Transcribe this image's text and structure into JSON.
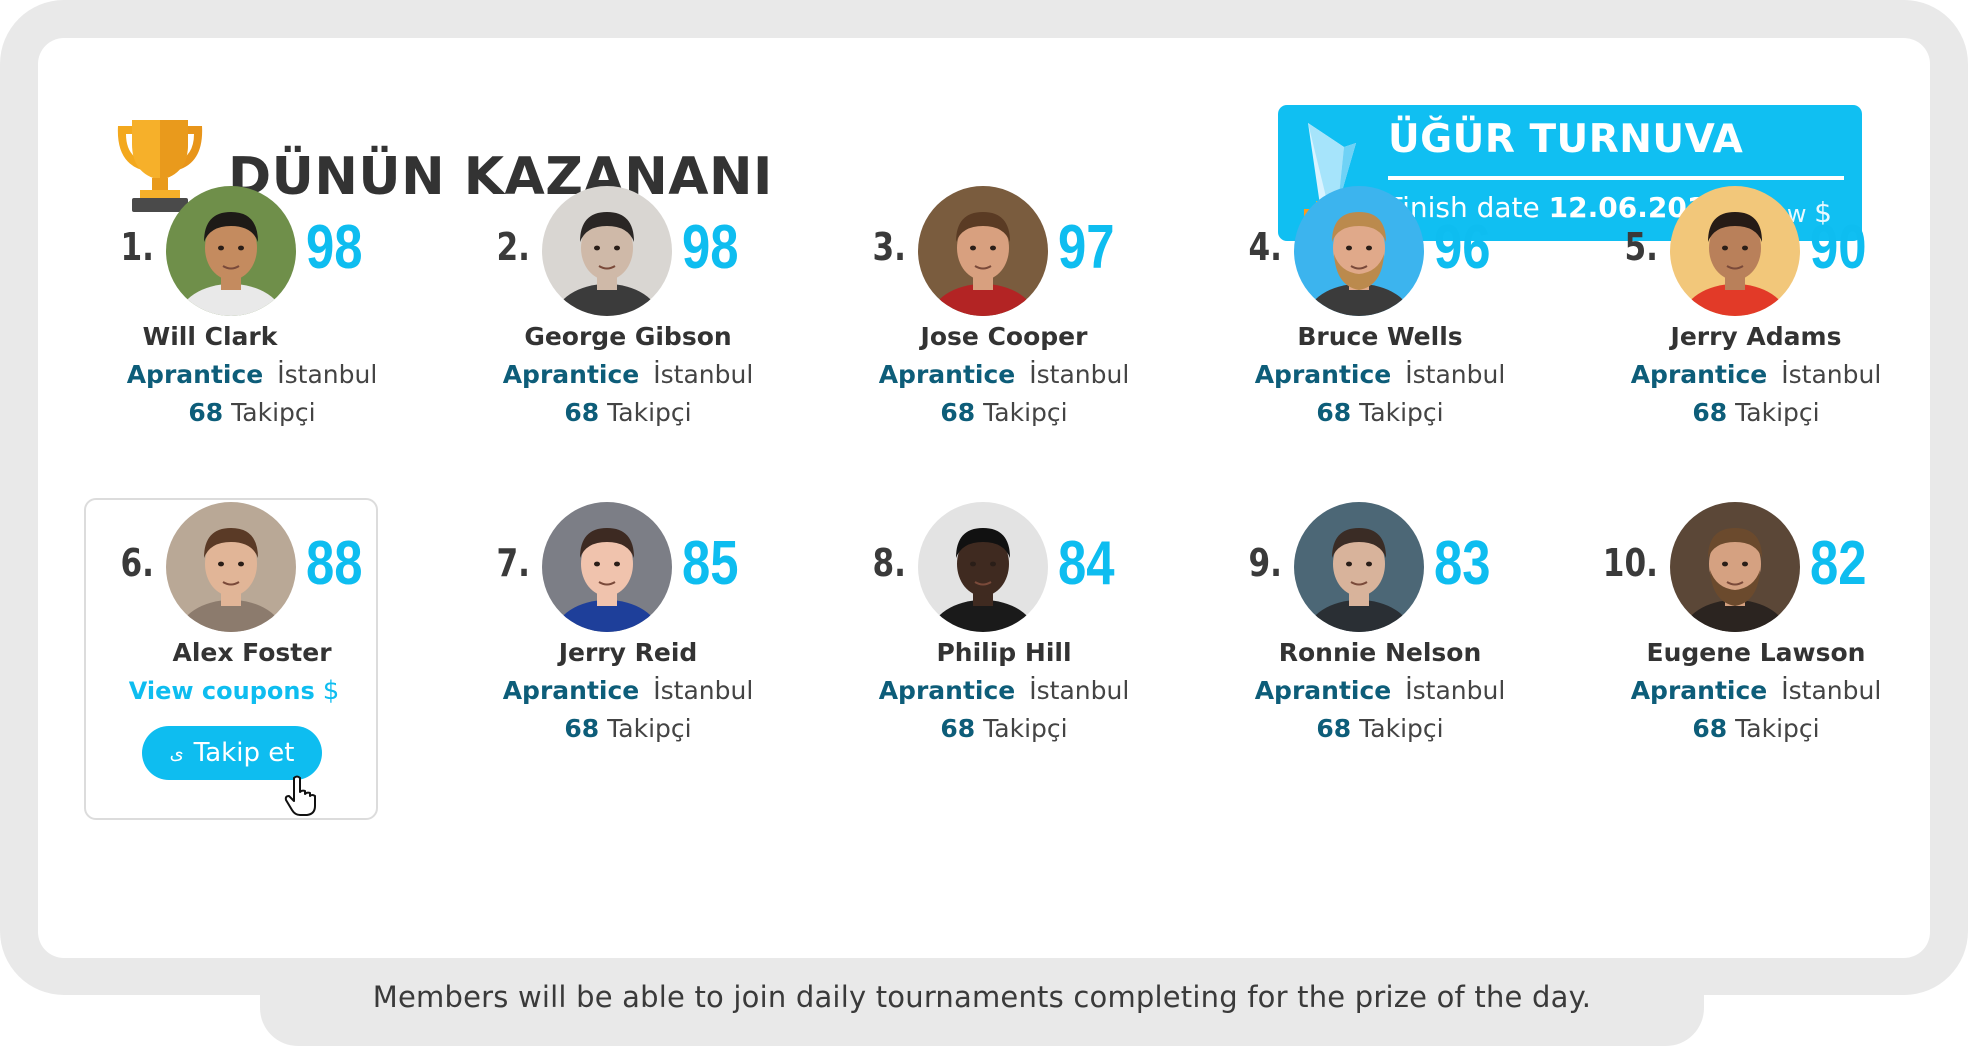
{
  "header": {
    "title": "DÜNÜN KAZANANI",
    "icon": "trophy-icon"
  },
  "tournament": {
    "title": "ÜĞÜR TURNUVA",
    "finish_label": "Finish date",
    "finish_date": "12.06.2019",
    "view_label": "View",
    "currency_symbol": "$",
    "color": "#10bff2"
  },
  "winners": [
    {
      "rank": "1.",
      "score": "98",
      "name": "Will Clark",
      "level": "Aprantice",
      "city": "İstanbul",
      "followers_count": "68",
      "followers_label": "Takipçi"
    },
    {
      "rank": "2.",
      "score": "98",
      "name": "George Gibson",
      "level": "Aprantice",
      "city": "İstanbul",
      "followers_count": "68",
      "followers_label": "Takipçi"
    },
    {
      "rank": "3.",
      "score": "97",
      "name": "Jose Cooper",
      "level": "Aprantice",
      "city": "İstanbul",
      "followers_count": "68",
      "followers_label": "Takipçi"
    },
    {
      "rank": "4.",
      "score": "96",
      "name": "Bruce Wells",
      "level": "Aprantice",
      "city": "İstanbul",
      "followers_count": "68",
      "followers_label": "Takipçi"
    },
    {
      "rank": "5.",
      "score": "90",
      "name": "Jerry Adams",
      "level": "Aprantice",
      "city": "İstanbul",
      "followers_count": "68",
      "followers_label": "Takipçi"
    },
    {
      "rank": "6.",
      "score": "88",
      "name": "Alex Foster",
      "coupons_label": "View coupons",
      "coupons_symbol": "$",
      "follow_label": "Takip et",
      "state": "hover"
    },
    {
      "rank": "7.",
      "score": "85",
      "name": "Jerry Reid",
      "level": "Aprantice",
      "city": "İstanbul",
      "followers_count": "68",
      "followers_label": "Takipçi"
    },
    {
      "rank": "8.",
      "score": "84",
      "name": "Philip Hill",
      "level": "Aprantice",
      "city": "İstanbul",
      "followers_count": "68",
      "followers_label": "Takipçi"
    },
    {
      "rank": "9.",
      "score": "83",
      "name": "Ronnie Nelson",
      "level": "Aprantice",
      "city": "İstanbul",
      "followers_count": "68",
      "followers_label": "Takipçi"
    },
    {
      "rank": "10.",
      "score": "82",
      "name": "Eugene Lawson",
      "level": "Aprantice",
      "city": "İstanbul",
      "followers_count": "68",
      "followers_label": "Takipçi"
    }
  ],
  "caption": "Members will be able to join daily tournaments completing for the prize of the day.",
  "colors": {
    "accent": "#0ebdf0",
    "level_text": "#0d5d79",
    "frame": "#e9e9e9"
  }
}
